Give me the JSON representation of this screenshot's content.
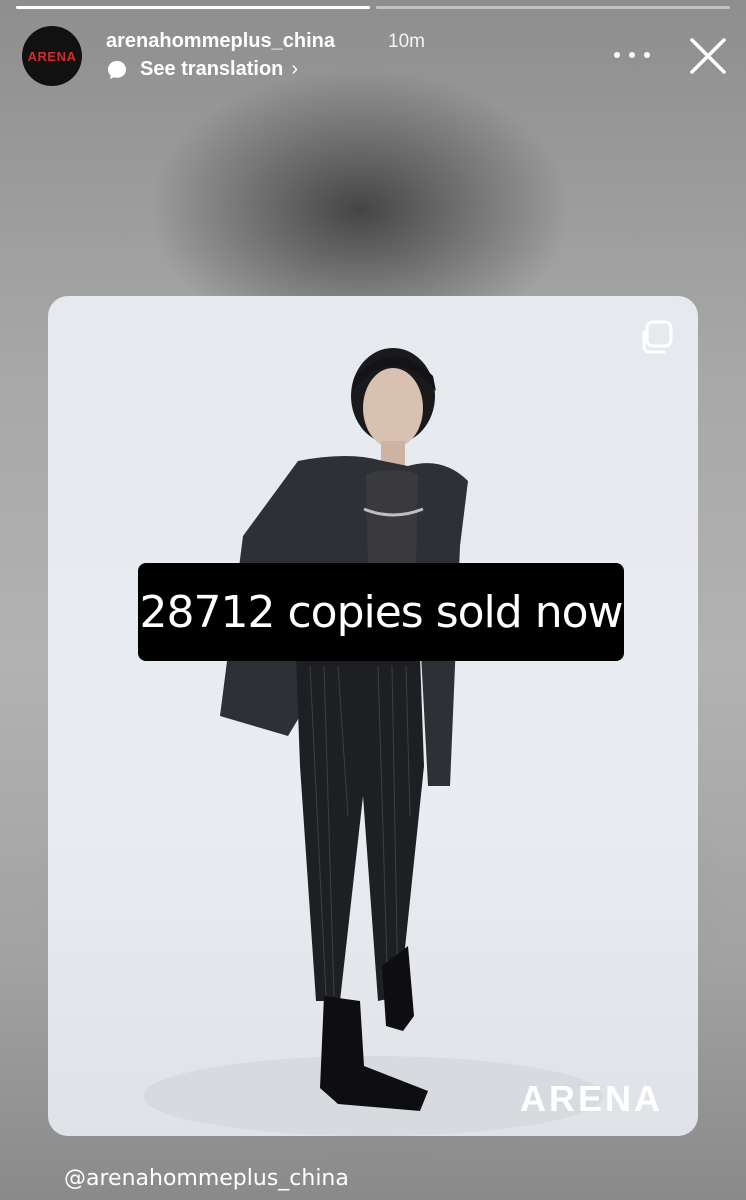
{
  "story": {
    "progress": [
      1,
      0
    ],
    "account": {
      "avatar_text": "ARENA",
      "username": "arenahommeplus_china",
      "time_ago": "10m"
    },
    "translation": {
      "label": "See translation"
    },
    "post": {
      "sticker_text": "28712 copies sold now",
      "brand_text": "ARENA"
    },
    "mention": "@arenahommeplus_china"
  },
  "colors": {
    "sticker_bg": "#000000",
    "card_bg": "#e8ebef",
    "avatar_text": "#d32c2c"
  },
  "icons": [
    "chat-bubble-icon",
    "chevron-right-icon",
    "more-icon",
    "close-icon",
    "multiple-posts-icon"
  ]
}
